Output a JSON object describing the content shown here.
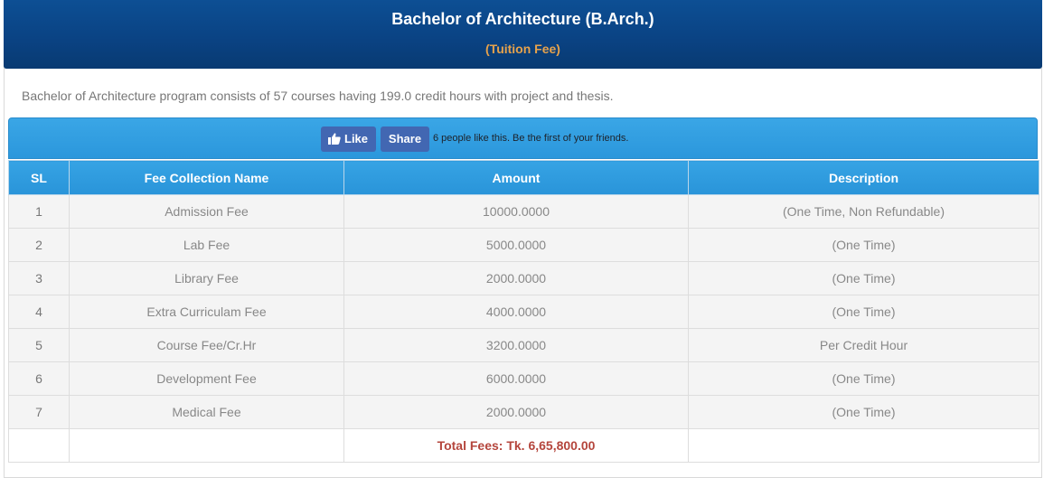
{
  "header": {
    "title": "Bachelor of Architecture (B.Arch.)",
    "subtitle": "(Tuition Fee)"
  },
  "intro": "Bachelor of Architecture program consists of 57 courses having 199.0 credit hours with project and thesis.",
  "social": {
    "like_label": "Like",
    "share_label": "Share",
    "like_text": "6 people like this. Be the first of your friends."
  },
  "table": {
    "columns": [
      "SL",
      "Fee Collection Name",
      "Amount",
      "Description"
    ],
    "rows": [
      {
        "sl": "1",
        "name": "Admission Fee",
        "amount": "10000.0000",
        "description": "(One Time, Non Refundable)"
      },
      {
        "sl": "2",
        "name": "Lab Fee",
        "amount": "5000.0000",
        "description": "(One Time)"
      },
      {
        "sl": "3",
        "name": "Library Fee",
        "amount": "2000.0000",
        "description": "(One Time)"
      },
      {
        "sl": "4",
        "name": "Extra Curriculam Fee",
        "amount": "4000.0000",
        "description": "(One Time)"
      },
      {
        "sl": "5",
        "name": "Course Fee/Cr.Hr",
        "amount": "3200.0000",
        "description": "Per Credit Hour"
      },
      {
        "sl": "6",
        "name": "Development Fee",
        "amount": "6000.0000",
        "description": "(One Time)"
      },
      {
        "sl": "7",
        "name": "Medical Fee",
        "amount": "2000.0000",
        "description": "(One Time)"
      }
    ],
    "total": "Total Fees: Tk. 6,65,800.00"
  },
  "colors": {
    "header_bg": "#0a4384",
    "subtitle": "#e6a24c",
    "bar_bg": "#2b97dc",
    "facebook": "#4267b2",
    "total_text": "#b4453c"
  }
}
